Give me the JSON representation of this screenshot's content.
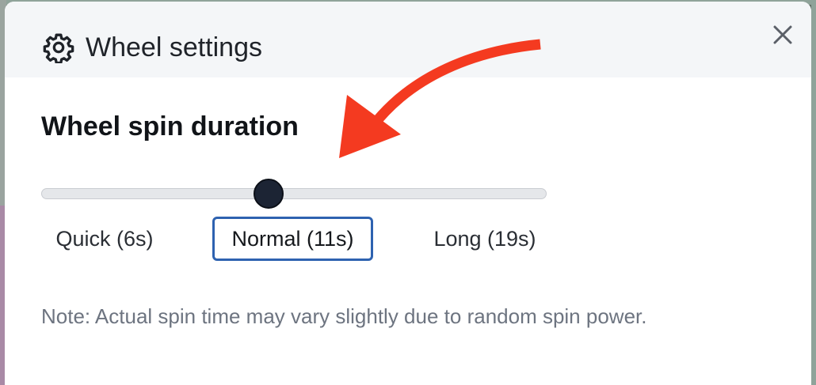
{
  "dialog": {
    "title": "Wheel settings",
    "icon": "gear-icon",
    "close_icon": "close-icon"
  },
  "spin_duration": {
    "title": "Wheel spin duration",
    "slider": {
      "min_seconds": 6,
      "max_seconds": 19,
      "value_seconds": 11,
      "thumb_color": "#1c2434"
    },
    "presets": [
      {
        "label": "Quick (6s)",
        "selected": false
      },
      {
        "label": "Normal (11s)",
        "selected": true
      },
      {
        "label": "Long (19s)",
        "selected": false
      }
    ],
    "selected_border_color": "#2e62b0",
    "note": "Note: Actual spin time may vary slightly due to random spin power."
  },
  "annotation": {
    "arrow_color": "#f43a20"
  }
}
